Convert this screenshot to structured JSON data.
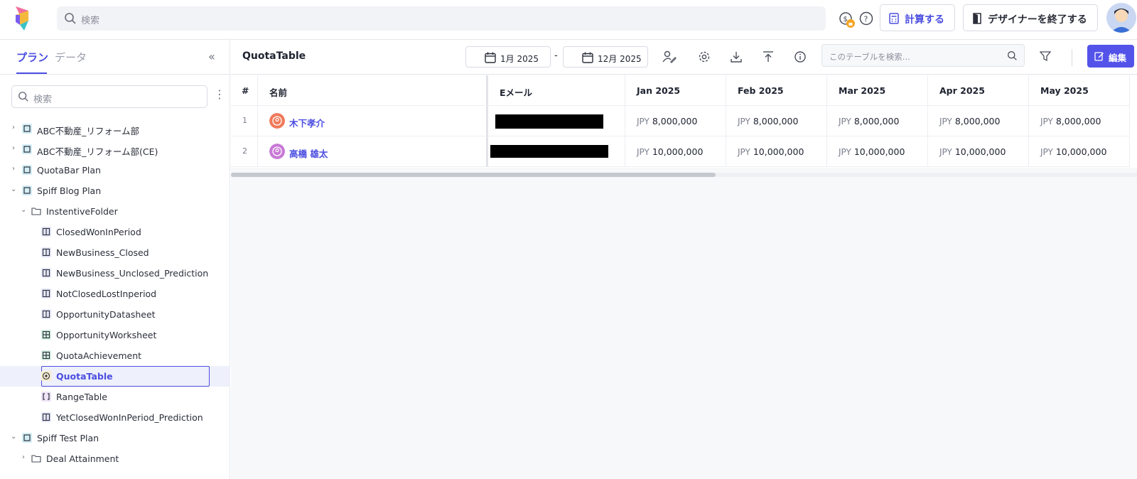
{
  "topbar": {
    "search_placeholder": "検索",
    "calc_label": "計算する",
    "exit_label": "デザイナーを終了する"
  },
  "sidebar": {
    "tab_plan": "プラン",
    "tab_data": "データ",
    "search_placeholder": "検索",
    "items": [
      {
        "label": "ABC不動産_リフォーム部",
        "icon": "book-icon",
        "level": 0,
        "chevron": "right"
      },
      {
        "label": "ABC不動産_リフォーム部(CE)",
        "icon": "book-icon",
        "level": 0,
        "chevron": "right"
      },
      {
        "label": "QuotaBar Plan",
        "icon": "book-icon",
        "level": 0,
        "chevron": "right"
      },
      {
        "label": "Spiff Blog Plan",
        "icon": "book-icon",
        "level": 0,
        "chevron": "down"
      },
      {
        "label": "InstentiveFolder",
        "icon": "folder-icon",
        "level": 1,
        "chevron": "down"
      },
      {
        "label": "ClosedWonInPeriod",
        "icon": "datasheet-icon",
        "level": 2
      },
      {
        "label": "NewBusiness_Closed",
        "icon": "datasheet-icon",
        "level": 2
      },
      {
        "label": "NewBusiness_Unclosed_Prediction",
        "icon": "datasheet-icon",
        "level": 2
      },
      {
        "label": "NotClosedLostInperiod",
        "icon": "datasheet-icon",
        "level": 2
      },
      {
        "label": "OpportunityDatasheet",
        "icon": "datasheet-icon",
        "level": 2
      },
      {
        "label": "OpportunityWorksheet",
        "icon": "worksheet-icon",
        "level": 2
      },
      {
        "label": "QuotaAchievement",
        "icon": "worksheet-icon",
        "level": 2
      },
      {
        "label": "QuotaTable",
        "icon": "target-icon",
        "level": 2,
        "selected": true
      },
      {
        "label": "RangeTable",
        "icon": "bracket-icon",
        "level": 2
      },
      {
        "label": "YetClosedWonInPeriod_Prediction",
        "icon": "datasheet-icon",
        "level": 2
      },
      {
        "label": "Spiff Test Plan",
        "icon": "book-icon",
        "level": 0,
        "chevron": "down"
      },
      {
        "label": "Deal Attainment",
        "icon": "folder-icon",
        "level": 1,
        "chevron": "right"
      }
    ]
  },
  "main": {
    "title": "QuotaTable",
    "date_from": "1月 2025",
    "date_sep": "-",
    "date_to": "12月 2025",
    "search_placeholder": "このテーブルを検索...",
    "edit_label": "編集",
    "columns": [
      "#",
      "名前",
      "Eメール",
      "Jan 2025",
      "Feb 2025",
      "Mar 2025",
      "Apr 2025",
      "May 2025"
    ],
    "rows": [
      {
        "num": "1",
        "name": "木下孝介",
        "avatar_color": "#f07a5a",
        "currency": "JPY",
        "values": [
          "8,000,000",
          "8,000,000",
          "8,000,000",
          "8,000,000",
          "8,000,000"
        ]
      },
      {
        "num": "2",
        "name": "高橋 雄太",
        "avatar_color": "#c879d6",
        "currency": "JPY",
        "values": [
          "10,000,000",
          "10,000,000",
          "10,000,000",
          "10,000,000",
          "10,000,000"
        ]
      }
    ]
  },
  "colors": {
    "accent": "#4b4ee0",
    "edit_button": "#5353ea"
  }
}
